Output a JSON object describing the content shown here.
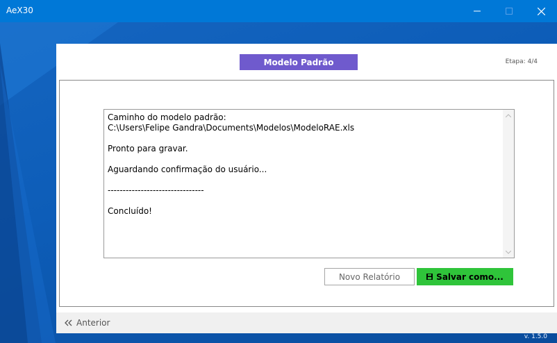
{
  "window": {
    "title": "AeX30",
    "minimize_glyph": "—",
    "maximize_glyph": "☐",
    "close_glyph": "✕"
  },
  "header": {
    "title": "Modelo Padrão",
    "step": "Etapa: 4/4"
  },
  "log": {
    "lines": "Caminho do modelo padrão:\nC:\\Users\\Felipe Gandra\\Documents\\Modelos\\ModeloRAE.xls\n\nPronto para gravar.\n\nAguardando confirmação do usuário...\n\n--------------------------------\n\nConcluído!"
  },
  "actions": {
    "new_report": "Novo Relatório",
    "save_as": "Salvar como..."
  },
  "footer": {
    "back_label": "Anterior",
    "version": "v. 1.5.0"
  },
  "colors": {
    "titlebar": "#0078d7",
    "header_button": "#6f5acd",
    "save_button": "#2fc43a"
  },
  "icons": {
    "save": "floppy-disk-icon",
    "back": "double-chevron-left-icon"
  }
}
